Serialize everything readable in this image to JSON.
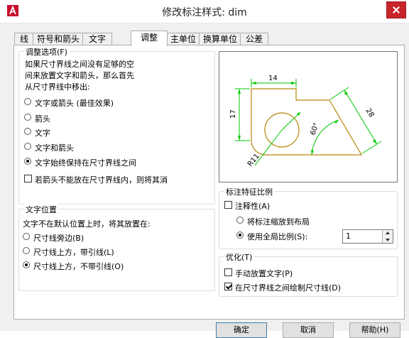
{
  "window": {
    "title": "修改标注样式: dim"
  },
  "tabs": [
    {
      "label": "线"
    },
    {
      "label": "符号和箭头"
    },
    {
      "label": "文字"
    },
    {
      "label": "调整",
      "active": true
    },
    {
      "label": "主单位"
    },
    {
      "label": "换算单位"
    },
    {
      "label": "公差"
    }
  ],
  "fit_options": {
    "title": "调整选项(F)",
    "description": [
      "如果尺寸界线之间没有足够的空",
      "间来放置文字和箭头，那么首先",
      "从尺寸界线中移出:"
    ],
    "radios": [
      {
        "label": "文字或箭头 (最佳效果)",
        "selected": false
      },
      {
        "label": "箭头",
        "selected": false
      },
      {
        "label": "文字",
        "selected": false
      },
      {
        "label": "文字和箭头",
        "selected": false
      },
      {
        "label": "文字始终保持在尺寸界线之间",
        "selected": true
      }
    ],
    "suppress_checkbox": {
      "label": "若箭头不能放在尺寸界线内，则将其消",
      "checked": false
    }
  },
  "text_placement": {
    "title": "文字位置",
    "description": "文字不在默认位置上时，将其放置在:",
    "radios": [
      {
        "label": "尺寸线旁边(B)",
        "selected": false
      },
      {
        "label": "尺寸线上方，带引线(L)",
        "selected": false
      },
      {
        "label": "尺寸线上方，不带引线(O)",
        "selected": true
      }
    ]
  },
  "preview": {
    "dim_labels": {
      "top": "14",
      "left": "17",
      "right": "28",
      "angle": "60°",
      "radius": "R11"
    },
    "colors": {
      "dim": "#00c800",
      "geometry": "#b8860b"
    }
  },
  "scale": {
    "title": "标注特征比例",
    "annotative": {
      "label": "注释性(A)",
      "checked": false
    },
    "layout_radio": {
      "label": "将标注缩放到布局",
      "selected": false
    },
    "overall_radio": {
      "label": "使用全局比例(S):",
      "selected": true
    },
    "overall_value": "1"
  },
  "fine_tuning": {
    "title": "优化(T)",
    "manual": {
      "label": "手动放置文字(P)",
      "checked": false
    },
    "draw_line": {
      "label": "在尺寸界线之间绘制尺寸线(D)",
      "checked": true
    }
  },
  "buttons": {
    "ok": "确定",
    "cancel": "取消",
    "help": "帮助(H)"
  },
  "icons": {
    "app": "autocad-a-icon",
    "close": "close-icon"
  }
}
